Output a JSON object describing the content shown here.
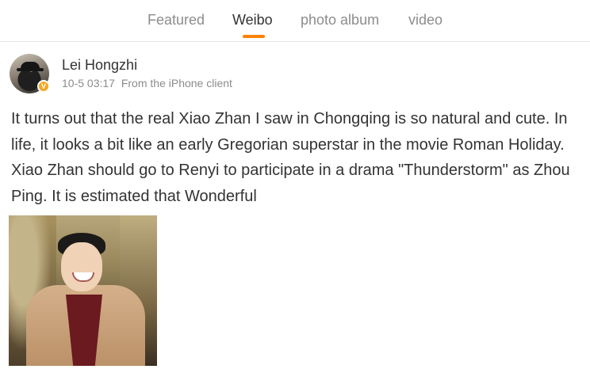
{
  "tabs": [
    {
      "label": "Featured",
      "active": false
    },
    {
      "label": "Weibo",
      "active": true
    },
    {
      "label": "photo album",
      "active": false
    },
    {
      "label": "video",
      "active": false
    }
  ],
  "accent_color": "#ff8200",
  "post": {
    "author": "Lei Hongzhi",
    "verified_badge": "V",
    "timestamp": "10-5 03:17",
    "source": "From the iPhone client",
    "text": "It turns out that the real Xiao Zhan I saw in Chongqing is so natural and cute. In life, it looks a bit like an early Gregorian superstar in the movie Roman Holiday. Xiao Zhan should go to Renyi to participate in a drama \"Thunderstorm\" as Zhou Ping. It is estimated that Wonderful"
  }
}
